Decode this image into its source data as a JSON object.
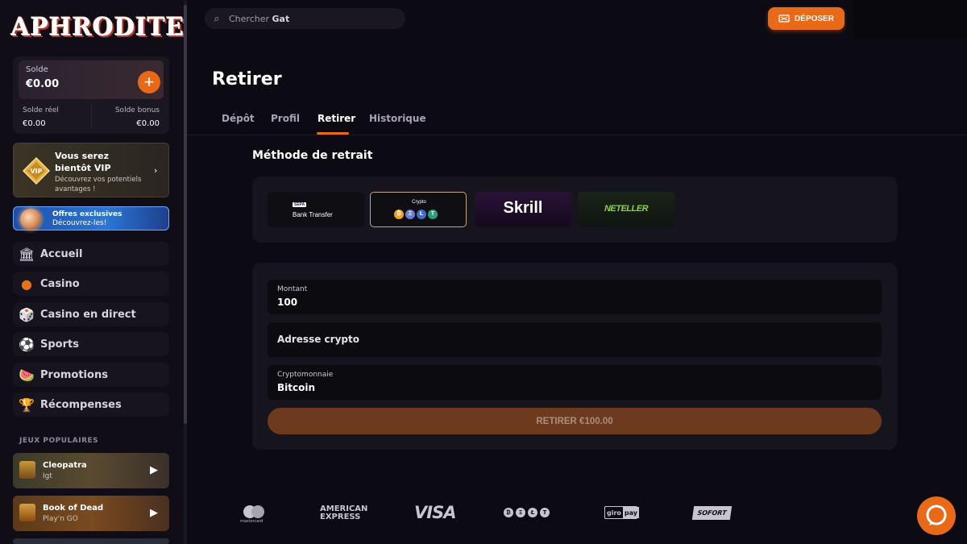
{
  "brand": {
    "name": "APHRODITE"
  },
  "balance": {
    "label": "Solde",
    "value": "€0.00",
    "add_symbol": "+",
    "real_label": "Solde réel",
    "real_value": "€0.00",
    "bonus_label": "Solde bonus",
    "bonus_value": "€0.00"
  },
  "vip": {
    "badge": "VIP",
    "title": "Vous serez bientôt VIP",
    "subtitle": "Découvrez vos potentiels avantages !",
    "chevron": "›"
  },
  "offers": {
    "title": "Offres exclusives",
    "subtitle": "Découvrez-les!"
  },
  "nav": [
    {
      "label": "Accueil",
      "icon": "bank-icon"
    },
    {
      "label": "Casino",
      "icon": "chip-icon"
    },
    {
      "label": "Casino en direct",
      "icon": "dice-icon"
    },
    {
      "label": "Sports",
      "icon": "soccer-ball-icon"
    },
    {
      "label": "Promotions",
      "icon": "watermelon-icon"
    },
    {
      "label": "Récompenses",
      "icon": "trophy-icon"
    }
  ],
  "popular": {
    "label": "JEUX POPULAIRES",
    "games": [
      {
        "name": "Cleopatra",
        "provider": "Igt"
      },
      {
        "name": "Book of Dead",
        "provider": "Play'n GO"
      }
    ]
  },
  "header": {
    "search_placeholder": "Chercher",
    "search_bold": "Gat",
    "deposit_label": "DÉPOSER"
  },
  "page": {
    "title": "Retirer",
    "tabs": [
      {
        "label": "Dépôt"
      },
      {
        "label": "Profil"
      },
      {
        "label": "Retirer",
        "active": true
      },
      {
        "label": "Historique"
      }
    ]
  },
  "withdraw": {
    "method_title": "Méthode de retrait",
    "methods": {
      "bank_badge": "SEPA",
      "bank_label": "Bank Transfer",
      "crypto_label": "Crypto",
      "crypto_coins": [
        "₿",
        "Ξ",
        "Ł",
        "T"
      ],
      "skrill": "Skrill",
      "neteller": "NETELLER"
    },
    "amount_label": "Montant",
    "amount_value": "100",
    "address_placeholder": "Adresse crypto",
    "currency_label": "Cryptomonnaie",
    "currency_value": "Bitcoin",
    "submit_label": "RETIRER €100.00"
  },
  "footer": {
    "mastercard": "mastercard",
    "amex_line1": "AMERICAN",
    "amex_line2": "EXPRESS",
    "visa": "VISA",
    "crypto_coins": [
      "₿",
      "Ξ",
      "Ł",
      "T"
    ],
    "giropay_1": "giro",
    "giropay_2": "pay",
    "sofort": "SOFORT"
  },
  "colors": {
    "accent": "#e86a18",
    "background": "#0c0a12",
    "panel": "#16141c"
  }
}
